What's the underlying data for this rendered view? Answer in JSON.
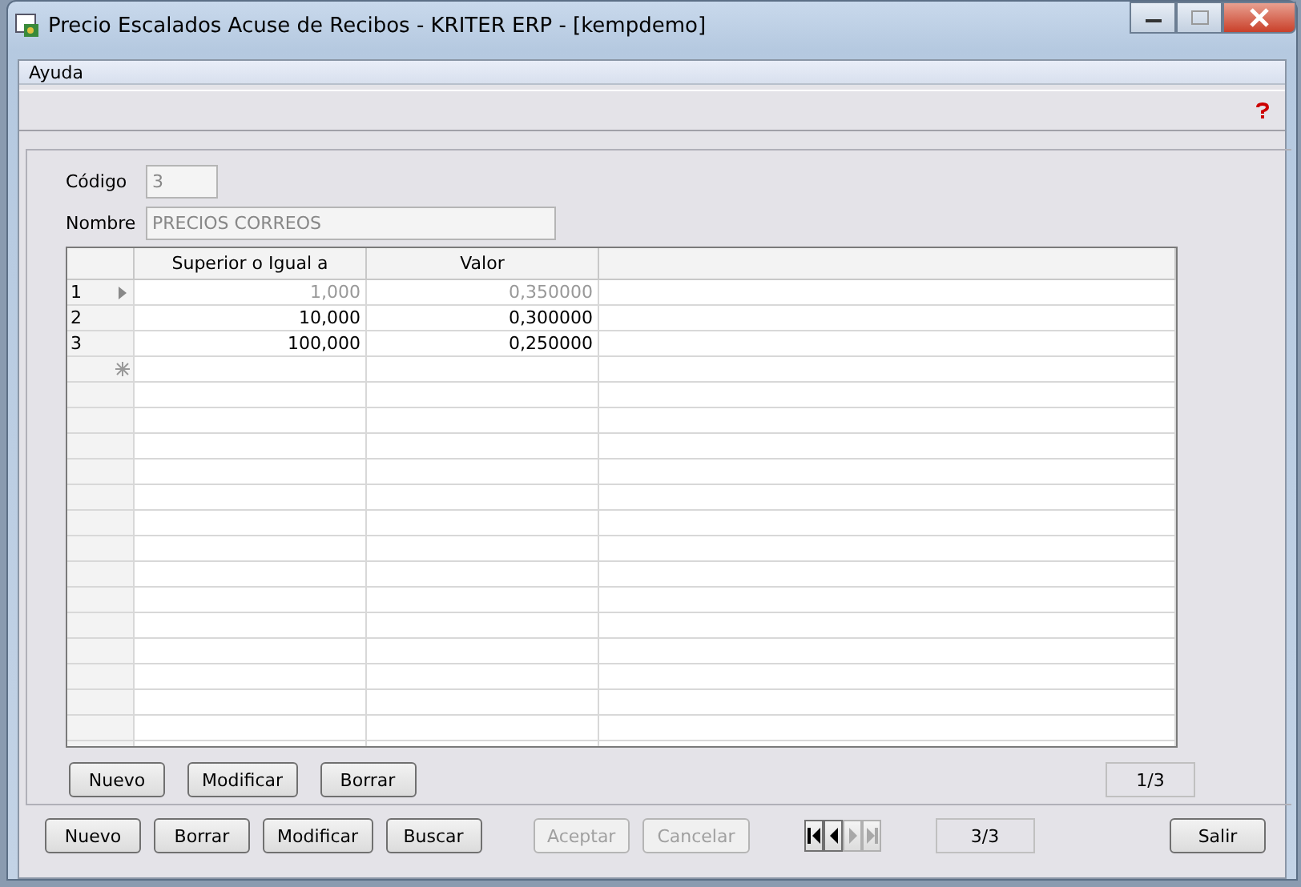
{
  "window": {
    "title": "Precio Escalados Acuse de Recibos - KRITER ERP - [kempdemo]"
  },
  "menu": [
    "Ayuda"
  ],
  "form": {
    "codigo": {
      "label": "Código",
      "value": "3"
    },
    "nombre": {
      "label": "Nombre",
      "value": "PRECIOS CORREOS"
    }
  },
  "table": {
    "columns": [
      "Superior o Igual a",
      "Valor"
    ],
    "rows": [
      {
        "number": "1",
        "cells": [
          "1,000",
          "0,350000"
        ],
        "selected": true
      },
      {
        "number": "2",
        "cells": [
          "10,000",
          "0,300000"
        ],
        "selected": false
      },
      {
        "number": "3",
        "cells": [
          "100,000",
          "0,250000"
        ],
        "selected": false
      }
    ]
  },
  "grid_buttons": [
    {
      "label": "Nuevo",
      "disabled": false
    },
    {
      "label": "Modificar",
      "disabled": false
    },
    {
      "label": "Borrar",
      "disabled": false
    }
  ],
  "grid_counter": "1/3",
  "buttons": [
    {
      "label": "Nuevo",
      "disabled": false
    },
    {
      "label": "Borrar",
      "disabled": false
    },
    {
      "label": "Modificar",
      "disabled": false
    },
    {
      "label": "Buscar",
      "disabled": false
    },
    {
      "label": "Aceptar",
      "disabled": true
    },
    {
      "label": "Cancelar",
      "disabled": true
    }
  ],
  "navigator": [
    {
      "kind": "first",
      "disabled": false
    },
    {
      "kind": "prev",
      "disabled": false
    },
    {
      "kind": "next",
      "disabled": true
    },
    {
      "kind": "last",
      "disabled": true
    }
  ],
  "record_counter": "3/3",
  "exit_button": {
    "label": "Salir",
    "disabled": false
  }
}
